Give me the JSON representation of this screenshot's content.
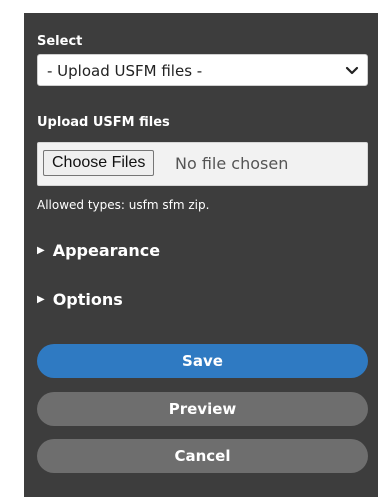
{
  "select": {
    "label": "Select",
    "value": "- Upload USFM files -"
  },
  "upload": {
    "label": "Upload USFM files",
    "button_label": "Choose Files",
    "status": "No file chosen",
    "hint": "Allowed types: usfm sfm zip."
  },
  "sections": {
    "appearance": "Appearance",
    "options": "Options"
  },
  "buttons": {
    "save": "Save",
    "preview": "Preview",
    "cancel": "Cancel"
  },
  "colors": {
    "panel_bg": "#3d3d3d",
    "primary": "#2f7ac2",
    "secondary": "#6e6e6e"
  },
  "icons": {
    "select_chevron": "chevron-down-icon",
    "disclosure": "triangle-right-icon"
  }
}
